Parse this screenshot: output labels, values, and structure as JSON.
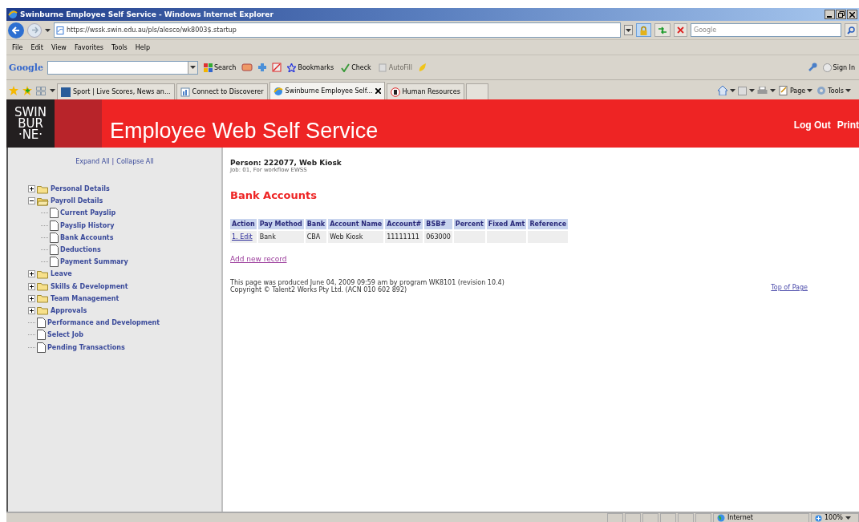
{
  "window": {
    "title": "Swinburne Employee Self Service - Windows Internet Explorer"
  },
  "address_bar": {
    "url": "https://wssk.swin.edu.au/pls/alesco/wk8003$.startup",
    "search_placeholder": "Google"
  },
  "menu_bar": [
    "File",
    "Edit",
    "View",
    "Favorites",
    "Tools",
    "Help"
  ],
  "google_toolbar": {
    "brand": "Google",
    "buttons": [
      {
        "label": "Search",
        "disabled": false
      },
      {
        "label": "Bookmarks",
        "disabled": false
      },
      {
        "label": "Check",
        "disabled": false
      },
      {
        "label": "AutoFill",
        "disabled": true
      }
    ],
    "sign_in": "Sign In"
  },
  "tabs": [
    {
      "label": "Sport | Live Scores, News an...",
      "selected": false
    },
    {
      "label": "Connect to Discoverer",
      "selected": false
    },
    {
      "label": "Swinburne Employee Self...",
      "selected": true
    },
    {
      "label": "Human Resources",
      "selected": false
    }
  ],
  "command_bar": [
    "Page",
    "Tools"
  ],
  "header": {
    "logo_lines": [
      "SWIN",
      "BUR",
      "·NE·"
    ],
    "title": "Employee Web Self Service",
    "links": [
      "Log Out",
      "Print"
    ]
  },
  "sidebar": {
    "expand_all": "Expand All",
    "separator": "|",
    "collapse_all": "Collapse All",
    "tree": [
      {
        "kind": "folder",
        "label": "Personal Details",
        "expanded": false
      },
      {
        "kind": "folder",
        "label": "Payroll Details",
        "expanded": true,
        "children": [
          {
            "kind": "page",
            "label": "Current Payslip"
          },
          {
            "kind": "page",
            "label": "Payslip History"
          },
          {
            "kind": "page",
            "label": "Bank Accounts"
          },
          {
            "kind": "page",
            "label": "Deductions"
          },
          {
            "kind": "page",
            "label": "Payment Summary"
          }
        ]
      },
      {
        "kind": "folder",
        "label": "Leave",
        "expanded": false
      },
      {
        "kind": "folder",
        "label": "Skills & Development",
        "expanded": false
      },
      {
        "kind": "folder",
        "label": "Team Management",
        "expanded": false
      },
      {
        "kind": "folder",
        "label": "Approvals",
        "expanded": false
      },
      {
        "kind": "page",
        "label": "Performance and Development"
      },
      {
        "kind": "page",
        "label": "Select Job"
      },
      {
        "kind": "page",
        "label": "Pending Transactions"
      }
    ]
  },
  "content": {
    "person": "Person: 222077, Web Kiosk",
    "job": "Job: 01, For workflow EWSS",
    "heading": "Bank Accounts",
    "table": {
      "columns": [
        "Action",
        "Pay Method",
        "Bank",
        "Account Name",
        "Account#",
        "BSB#",
        "Percent",
        "Fixed Amt",
        "Reference"
      ],
      "rows": [
        {
          "cells": [
            "1. Edit",
            "Bank",
            "CBA",
            "Web Kiosk",
            "11111111",
            "063000"
          ]
        }
      ]
    },
    "add_link": "Add new record",
    "footer": [
      "This page was produced June 04, 2009 09:59 am by program WK8101 (revision 10.4)",
      "Copyright © Talent2 Works Pty Ltd. (ACN 010 602 892)"
    ],
    "top_link": "Top of Page"
  },
  "status_bar": {
    "zone": "Internet",
    "zoom": "100%"
  }
}
